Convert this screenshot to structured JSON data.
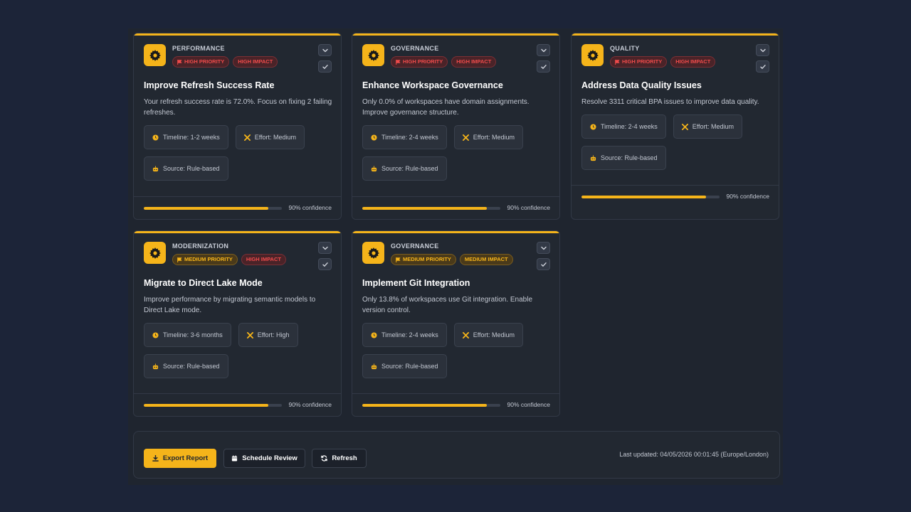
{
  "cards": [
    {
      "category": "PERFORMANCE",
      "priority": "HIGH PRIORITY",
      "impact": "HIGH IMPACT",
      "title": "Improve Refresh Success Rate",
      "description": "Your refresh success rate is 72.0%. Focus on fixing 2 failing refreshes.",
      "timeline": "Timeline: 1-2 weeks",
      "effort": "Effort: Medium",
      "source": "Source: Rule-based",
      "confidence_label": "90% confidence",
      "confidence": 0.9
    },
    {
      "category": "GOVERNANCE",
      "priority": "HIGH PRIORITY",
      "impact": "HIGH IMPACT",
      "title": "Enhance Workspace Governance",
      "description": "Only 0.0% of workspaces have domain assignments. Improve governance structure.",
      "timeline": "Timeline: 2-4 weeks",
      "effort": "Effort: Medium",
      "source": "Source: Rule-based",
      "confidence_label": "90% confidence",
      "confidence": 0.9
    },
    {
      "category": "QUALITY",
      "priority": "HIGH PRIORITY",
      "impact": "HIGH IMPACT",
      "title": "Address Data Quality Issues",
      "description": "Resolve 3311 critical BPA issues to improve data quality.",
      "timeline": "Timeline: 2-4 weeks",
      "effort": "Effort: Medium",
      "source": "Source: Rule-based",
      "confidence_label": "90% confidence",
      "confidence": 0.9
    },
    {
      "category": "MODERNIZATION",
      "priority": "MEDIUM PRIORITY",
      "impact": "HIGH IMPACT",
      "title": "Migrate to Direct Lake Mode",
      "description": "Improve performance by migrating semantic models to Direct Lake mode.",
      "timeline": "Timeline: 3-6 months",
      "effort": "Effort: High",
      "source": "Source: Rule-based",
      "confidence_label": "90% confidence",
      "confidence": 0.9
    },
    {
      "category": "GOVERNANCE",
      "priority": "MEDIUM PRIORITY",
      "impact": "MEDIUM IMPACT",
      "title": "Implement Git Integration",
      "description": "Only 13.8% of workspaces use Git integration. Enable version control.",
      "timeline": "Timeline: 2-4 weeks",
      "effort": "Effort: Medium",
      "source": "Source: Rule-based",
      "confidence_label": "90% confidence",
      "confidence": 0.9
    }
  ],
  "actions": {
    "export_label": "Export Report",
    "schedule_label": "Schedule Review",
    "refresh_label": "Refresh",
    "last_updated": "Last updated: 04/05/2026 00:01:45 (Europe/London)"
  },
  "colors": {
    "accent": "#f5b41a",
    "high": "#ef4b4b",
    "background": "#1c2438",
    "card": "#222831"
  },
  "icons": {
    "card": "gear-icon",
    "priority": "flag-icon",
    "collapse": "chevron-down-icon",
    "complete": "check-icon",
    "timeline": "clock-icon",
    "effort": "tools-icon",
    "source": "robot-icon",
    "export": "download-icon",
    "schedule": "calendar-icon",
    "refresh": "refresh-icon"
  }
}
